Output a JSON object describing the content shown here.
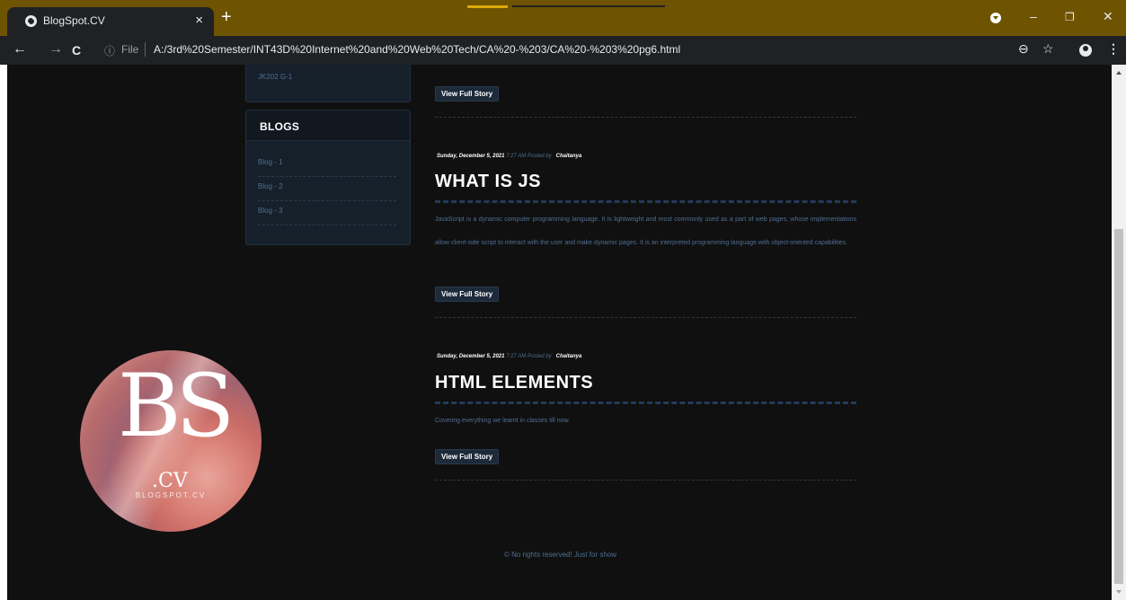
{
  "browser": {
    "tab_title": "BlogSpot.CV",
    "tab_close": "×",
    "new_tab": "+",
    "address_info_icon": "ⓘ",
    "address_scheme": "File",
    "url": "A:/3rd%20Semester/INT43D%20Internet%20and%20Web%20Tech/CA%20-%203/CA%20-%203%20pg6.html",
    "nav": {
      "back": "←",
      "forward": "→",
      "reload": "C"
    },
    "toolbar_icons": {
      "zoom": "⊖",
      "bookmark": "☆",
      "menu": "⋮"
    },
    "window_buttons": {
      "minimize": "–",
      "restore": "❐",
      "close": "✕"
    }
  },
  "sidebar": {
    "top_box_text": "JK202 G-1",
    "blogs_heading": "BLOGS",
    "blog_links": [
      {
        "label": "Blog - 1"
      },
      {
        "label": "Blog - 2"
      },
      {
        "label": "Blog - 3"
      }
    ]
  },
  "logo": {
    "letters": "BS",
    "suffix": ".CV",
    "caption": "BLOGSPOT.CV"
  },
  "posts": [
    {
      "button": "View Full Story"
    },
    {
      "date": "Sunday, December 5, 2021",
      "time_posted": "7:27 AM Posted by",
      "author": "Chaitanya",
      "title": "WHAT IS JS",
      "body": "JavaScript is a dynamic computer programming language. It is lightweight and most commonly used as a part of web pages, whose implementations allow client-side script to interact with the user and make dynamic pages. It is an interpreted programming language with object-oriented capabilities.",
      "button": "View Full Story"
    },
    {
      "date": "Sunday, December 5, 2021",
      "time_posted": "7:27 AM Posted by",
      "author": "Chaitanya",
      "title": "HTML ELEMENTS",
      "body": "Covering everything we learnt in classes till now.",
      "button": "View Full Story"
    }
  ],
  "footer": "© No rights reserved! Just for show"
}
